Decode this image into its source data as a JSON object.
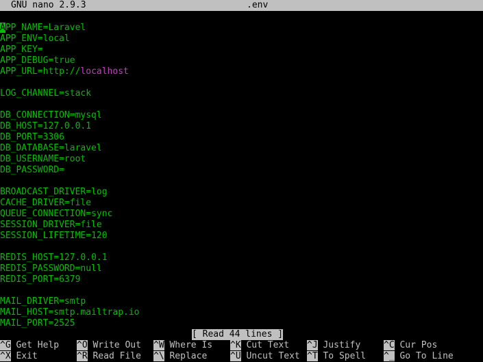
{
  "title_bar": {
    "app": "GNU nano 2.9.3",
    "filename": ".env"
  },
  "colors": {
    "background": "#000000",
    "bar": "#c0c0c0",
    "key_name": "#00c000",
    "url_value": "#c040c0",
    "text": "#c0c0c0",
    "cursor": "#00c000"
  },
  "editor": {
    "lines": [
      {
        "k": "APP_NAME",
        "eq": "=",
        "v": "Laravel"
      },
      {
        "k": "APP_ENV",
        "eq": "=",
        "v": "local"
      },
      {
        "k": "APP_KEY",
        "eq": "=",
        "v": ""
      },
      {
        "k": "APP_DEBUG",
        "eq": "=",
        "v": "true"
      },
      {
        "k": "APP_URL",
        "eq": "=",
        "v": "http://",
        "v2": "localhost"
      },
      {
        "k": "",
        "eq": "",
        "v": ""
      },
      {
        "k": "LOG_CHANNEL",
        "eq": "=",
        "v": "stack"
      },
      {
        "k": "",
        "eq": "",
        "v": ""
      },
      {
        "k": "DB_CONNECTION",
        "eq": "=",
        "v": "mysql"
      },
      {
        "k": "DB_HOST",
        "eq": "=",
        "v": "127.0.0.1"
      },
      {
        "k": "DB_PORT",
        "eq": "=",
        "v": "3306"
      },
      {
        "k": "DB_DATABASE",
        "eq": "=",
        "v": "laravel"
      },
      {
        "k": "DB_USERNAME",
        "eq": "=",
        "v": "root"
      },
      {
        "k": "DB_PASSWORD",
        "eq": "=",
        "v": ""
      },
      {
        "k": "",
        "eq": "",
        "v": ""
      },
      {
        "k": "BROADCAST_DRIVER",
        "eq": "=",
        "v": "log"
      },
      {
        "k": "CACHE_DRIVER",
        "eq": "=",
        "v": "file"
      },
      {
        "k": "QUEUE_CONNECTION",
        "eq": "=",
        "v": "sync"
      },
      {
        "k": "SESSION_DRIVER",
        "eq": "=",
        "v": "file"
      },
      {
        "k": "SESSION_LIFETIME",
        "eq": "=",
        "v": "120"
      },
      {
        "k": "",
        "eq": "",
        "v": ""
      },
      {
        "k": "REDIS_HOST",
        "eq": "=",
        "v": "127.0.0.1"
      },
      {
        "k": "REDIS_PASSWORD",
        "eq": "=",
        "v": "null"
      },
      {
        "k": "REDIS_PORT",
        "eq": "=",
        "v": "6379"
      },
      {
        "k": "",
        "eq": "",
        "v": ""
      },
      {
        "k": "MAIL_DRIVER",
        "eq": "=",
        "v": "smtp"
      },
      {
        "k": "MAIL_HOST",
        "eq": "=",
        "v": "smtp.mailtrap.io"
      },
      {
        "k": "MAIL_PORT",
        "eq": "=",
        "v": "2525"
      }
    ]
  },
  "status": {
    "message": "[ Read 44 lines ]"
  },
  "shortcuts": {
    "row1": [
      {
        "key": "^G",
        "label": "Get Help"
      },
      {
        "key": "^O",
        "label": "Write Out"
      },
      {
        "key": "^W",
        "label": "Where Is"
      },
      {
        "key": "^K",
        "label": "Cut Text"
      },
      {
        "key": "^J",
        "label": "Justify"
      },
      {
        "key": "^C",
        "label": "Cur Pos"
      }
    ],
    "row2": [
      {
        "key": "^X",
        "label": "Exit"
      },
      {
        "key": "^R",
        "label": "Read File"
      },
      {
        "key": "^\\",
        "label": "Replace"
      },
      {
        "key": "^U",
        "label": "Uncut Text"
      },
      {
        "key": "^T",
        "label": "To Spell"
      },
      {
        "key": "^_",
        "label": "Go To Line"
      }
    ]
  }
}
